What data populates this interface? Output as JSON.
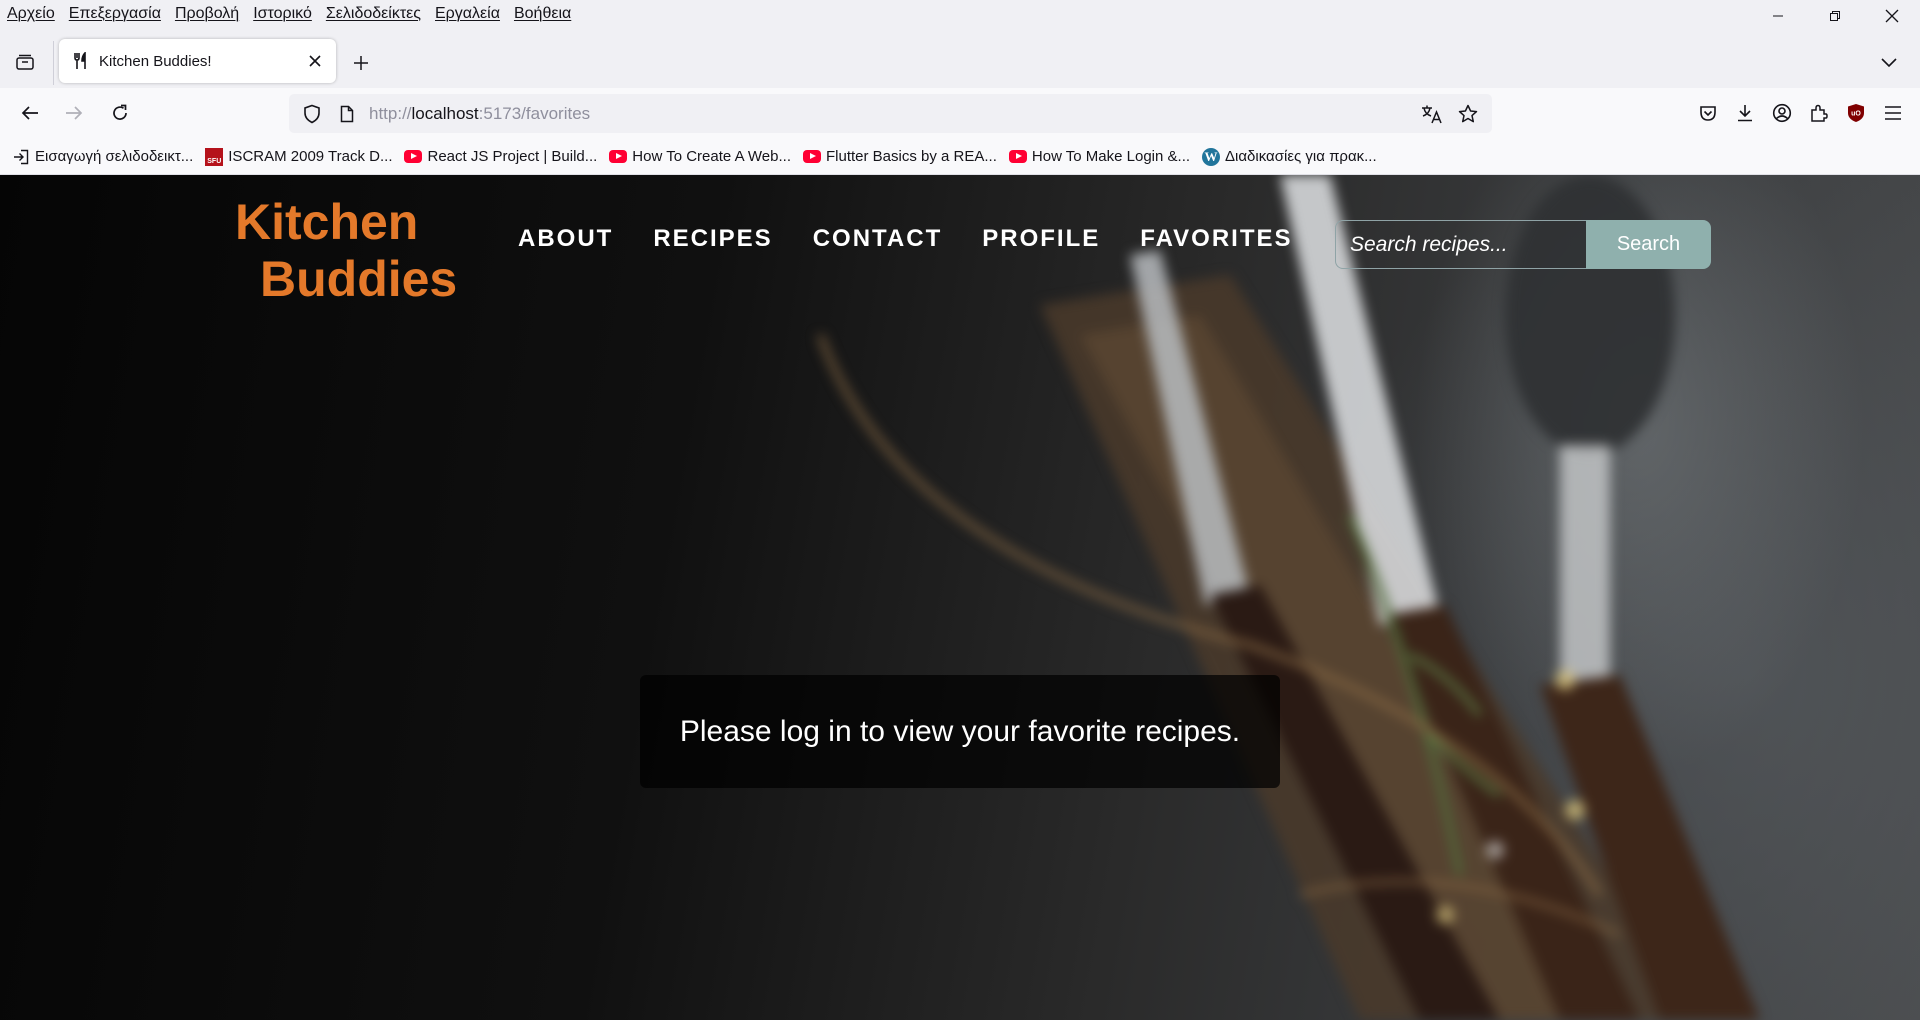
{
  "menubar": {
    "items": [
      "Αρχείο",
      "Επεξεργασία",
      "Προβολή",
      "Ιστορικό",
      "Σελιδοδείκτες",
      "Εργαλεία",
      "Βοήθεια"
    ]
  },
  "tabs": [
    {
      "title": "Kitchen Buddies!",
      "icon": "fork-knife-icon",
      "active": true
    }
  ],
  "address_bar": {
    "url_prefix": "http://",
    "url_host": "localhost",
    "url_path": ":5173/favorites"
  },
  "bookmarks": [
    {
      "label": "Εισαγωγή σελιδοδεικτ...",
      "icon": "import-icon"
    },
    {
      "label": "ISCRAM 2009 Track D...",
      "icon": "sfu-icon"
    },
    {
      "label": "React JS Project | Build...",
      "icon": "youtube-icon"
    },
    {
      "label": "How To Create A Web...",
      "icon": "youtube-icon"
    },
    {
      "label": "Flutter Basics by a REA...",
      "icon": "youtube-icon"
    },
    {
      "label": "How To Make Login &...",
      "icon": "youtube-icon"
    },
    {
      "label": "Διαδικασίες για πρακ...",
      "icon": "wordpress-icon"
    }
  ],
  "site": {
    "logo_line1": "Kitchen",
    "logo_line2": "Buddies",
    "nav": [
      "ABOUT",
      "RECIPES",
      "CONTACT",
      "PROFILE",
      "FAVORITES"
    ],
    "search_placeholder": "Search recipes...",
    "search_button": "Search",
    "message": "Please log in to view your favorite recipes."
  },
  "colors": {
    "logo": "#e4792a",
    "search_button": "#8fb0ad",
    "menubar_bg": "#f0f0f4",
    "toolbar_bg": "#f9f9fb"
  }
}
